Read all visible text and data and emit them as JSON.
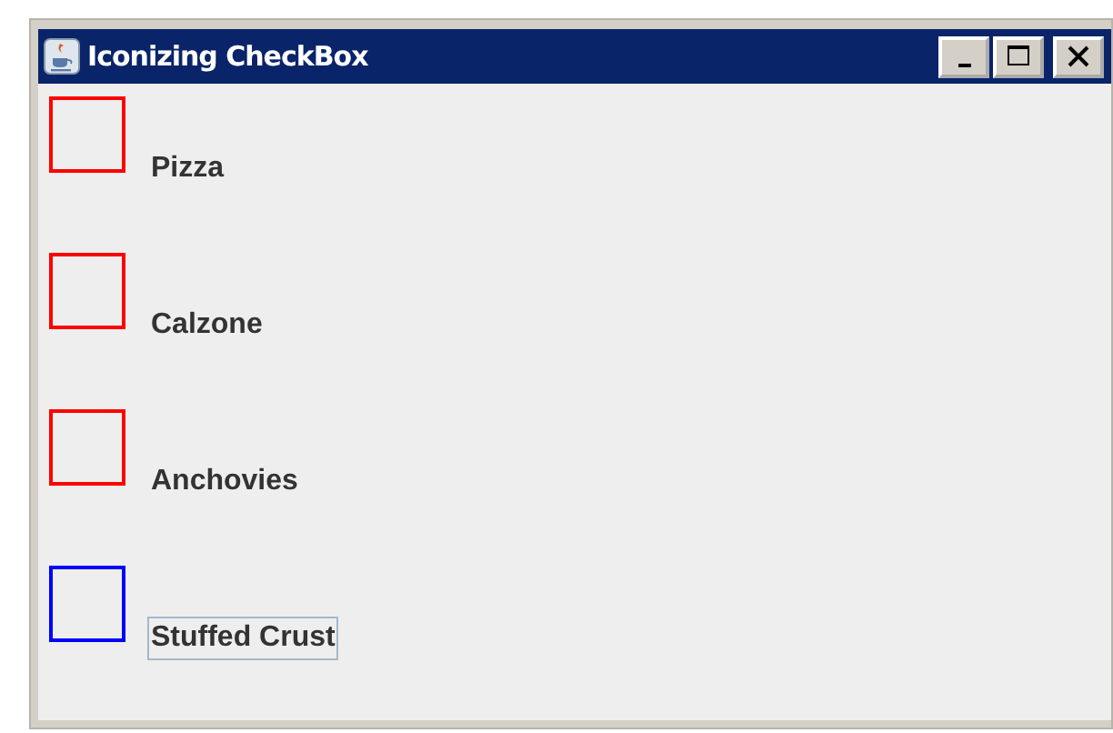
{
  "window": {
    "title": "Iconizing CheckBox"
  },
  "checkboxes": [
    {
      "label": "Pizza",
      "color": "#ff0000",
      "focused": false
    },
    {
      "label": "Calzone",
      "color": "#ff0000",
      "focused": false
    },
    {
      "label": "Anchovies",
      "color": "#ff0000",
      "focused": false
    },
    {
      "label": "Stuffed Crust",
      "color": "#0000ff",
      "focused": true
    }
  ]
}
